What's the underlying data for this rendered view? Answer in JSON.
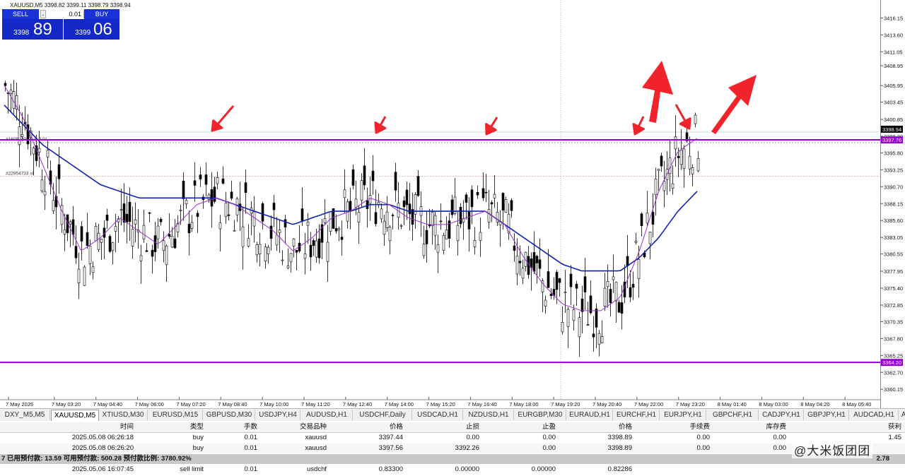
{
  "window": {
    "title": "XAUUSD,M5  3398.82 3399.11 3398.79 3398.94"
  },
  "trade_panel": {
    "sell_label": "SELL",
    "buy_label": "BUY",
    "lot": "0.01",
    "minus": "-",
    "plus": "+",
    "sell_small": "3398",
    "sell_big": "89",
    "buy_small": "3399",
    "buy_big": "06"
  },
  "chart": {
    "price_labels": [
      "3416.15",
      "3413.60",
      "3411.05",
      "3408.95",
      "3405.95",
      "3403.45",
      "3400.85",
      "3398.30",
      "3395.80",
      "3393.25",
      "3390.70",
      "3388.15",
      "3385.60",
      "3383.05",
      "3380.55",
      "3377.95",
      "3375.40",
      "3372.85",
      "3370.35",
      "3367.80",
      "3365.25",
      "3362.70",
      "3360.15"
    ],
    "current_price": "3398.94",
    "current_price_color": "#000000",
    "hline_label_upper": "3397.76",
    "hline_label_lower": "3364.20",
    "hline_color": "#9400d3",
    "order_label_1": "#16088393 buy 0.01",
    "order_label_2": "#22954733 sl",
    "time_labels": [
      "7 May 2025",
      "7 May 03:20",
      "7 May 04:40",
      "7 May 06:00",
      "7 May 07:20",
      "7 May 08:40",
      "7 May 10:00",
      "7 May 11:20",
      "7 May 12:40",
      "7 May 14:00",
      "7 May 15:20",
      "7 May 16:40",
      "7 May 18:00",
      "7 May 19:20",
      "7 May 20:40",
      "7 May 22:00",
      "7 May 23:20",
      "8 May 01:40",
      "8 May 03:00",
      "8 May 04:20",
      "8 May 05:40"
    ],
    "ma_fast_color": "#9b30d0",
    "ma_slow_color": "#1020b0",
    "arrow_color": "#f0242a"
  },
  "chart_data": {
    "type": "candlestick",
    "symbol": "XAUUSD",
    "timeframe": "M5",
    "ylim": [
      3359.0,
      3418.0
    ],
    "hlines": [
      3397.76,
      3364.2
    ],
    "last": 3398.94,
    "series": [
      {
        "name": "MA fast",
        "values": [
          3406,
          3401,
          3394,
          3387,
          3381,
          3383,
          3386,
          3384,
          3382,
          3385,
          3388,
          3389,
          3388,
          3386,
          3384,
          3381,
          3383,
          3386,
          3387,
          3389,
          3388,
          3386,
          3385,
          3385,
          3386,
          3387,
          3385,
          3380,
          3376,
          3373,
          3372,
          3372,
          3374,
          3381,
          3390,
          3396,
          3398
        ]
      },
      {
        "name": "MA slow",
        "values": [
          3403,
          3400,
          3397,
          3395,
          3393,
          3391,
          3390,
          3389,
          3389,
          3389,
          3389,
          3389,
          3388,
          3387,
          3386,
          3385,
          3386,
          3387,
          3387,
          3388,
          3388,
          3387,
          3387,
          3387,
          3387,
          3387,
          3385,
          3383,
          3381,
          3379,
          3378,
          3378,
          3378,
          3380,
          3383,
          3387,
          3390
        ]
      }
    ]
  },
  "tabs": [
    {
      "label": "DXY_M5,M5",
      "active": false
    },
    {
      "label": "XAUUSD,M5",
      "active": true
    },
    {
      "label": "XTIUSD,M30",
      "active": false
    },
    {
      "label": "EURUSD,M15",
      "active": false
    },
    {
      "label": "GBPUSD,M30",
      "active": false
    },
    {
      "label": "USDJPY,H4",
      "active": false
    },
    {
      "label": "AUDUSD,H1",
      "active": false
    },
    {
      "label": "USDCHF,Daily",
      "active": false
    },
    {
      "label": "USDCAD,H1",
      "active": false
    },
    {
      "label": "NZDUSD,H1",
      "active": false
    },
    {
      "label": "EURGBP,M30",
      "active": false
    },
    {
      "label": "EURAUD,H1",
      "active": false
    },
    {
      "label": "EURCHF,H1",
      "active": false
    },
    {
      "label": "EURJPY,H1",
      "active": false
    },
    {
      "label": "GBPCHF,H1",
      "active": false
    },
    {
      "label": "CADJPY,H1",
      "active": false
    },
    {
      "label": "GBPJPY,H1",
      "active": false
    },
    {
      "label": "AUDCAD,H1",
      "active": false
    },
    {
      "label": "AL",
      "active": false
    }
  ],
  "table": {
    "headers": [
      "时间",
      "类型",
      "手数",
      "交易品种",
      "价格",
      "止损",
      "止盈",
      "价格",
      "手续费",
      "库存费",
      "获利"
    ],
    "rows": [
      [
        "2025.05.08 06:26:18",
        "buy",
        "0.01",
        "xauusd",
        "3397.44",
        "0.00",
        "0.00",
        "3398.89",
        "0.00",
        "0.00",
        "1.45"
      ],
      [
        "2025.05.08 06:26:20",
        "buy",
        "0.01",
        "xauusd",
        "3397.56",
        "3392.26",
        "0.00",
        "3398.89",
        "0.00",
        "0.00",
        ""
      ]
    ],
    "summary": {
      "text": "7  已用预付款: 13.59  可用预付款: 500.28  预付款比例: 3780.92%",
      "profit": "2.78"
    },
    "pending": [
      "2025.05.06 16:07:45",
      "sell limit",
      "0.01",
      "usdchf",
      "0.83300",
      "0.00000",
      "0.00000",
      "0.82286",
      "",
      "",
      ""
    ]
  },
  "watermark": "@大米饭团团"
}
